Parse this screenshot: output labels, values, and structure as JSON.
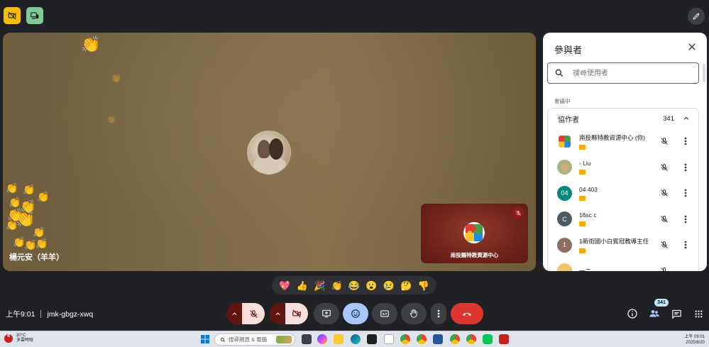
{
  "top_bar": {
    "left_icons": [
      "camera-off-icon",
      "devices-icon"
    ],
    "right_icon": "edit-background-icon"
  },
  "stage": {
    "participant_name": "楊元安（羊羊）",
    "reaction_emoji": "👏"
  },
  "self_view": {
    "name": "南投縣特教資源中心"
  },
  "panel": {
    "title": "參與者",
    "search_placeholder": "搜尋使用者",
    "section_label": "會議中",
    "group_title": "協作者",
    "group_count": "341",
    "participants": [
      {
        "name": "南投縣特教資源中心 (你)",
        "avatar_text": "",
        "avatar_color": "#ffffff"
      },
      {
        "name": "- Liu",
        "avatar_text": "",
        "avatar_color": "#a5b87a"
      },
      {
        "name": "04 403",
        "avatar_text": "04",
        "avatar_color": "#00897b"
      },
      {
        "name": "16sc c",
        "avatar_text": "C",
        "avatar_color": "#4f5b62"
      },
      {
        "name": "1新街國小白賓冠教導主任",
        "avatar_text": "1",
        "avatar_color": "#8d6e63"
      },
      {
        "name": "一二",
        "avatar_text": "",
        "avatar_color": "#f5c16c"
      }
    ]
  },
  "reactions": [
    "💖",
    "👍",
    "🎉",
    "👏",
    "😂",
    "😮",
    "😢",
    "🤔",
    "👎"
  ],
  "bottom_bar": {
    "time": "上午9:01",
    "meeting_code": "jmk-gbgz-xwq",
    "people_count": "341"
  },
  "taskbar": {
    "weather_temp": "30°C",
    "weather_desc": "多雲時陰",
    "weather_badge": "4",
    "search_placeholder": "搜尋網頁 & 電腦",
    "clock_time": "上午 09:01",
    "clock_date": "2025/8/20"
  },
  "colors": {
    "hangup": "#dc362e",
    "mic_off_bg": "#601410",
    "active_blue": "#a8c7fa",
    "yellow_btn": "#fbbc04",
    "green_btn": "#81c995"
  }
}
